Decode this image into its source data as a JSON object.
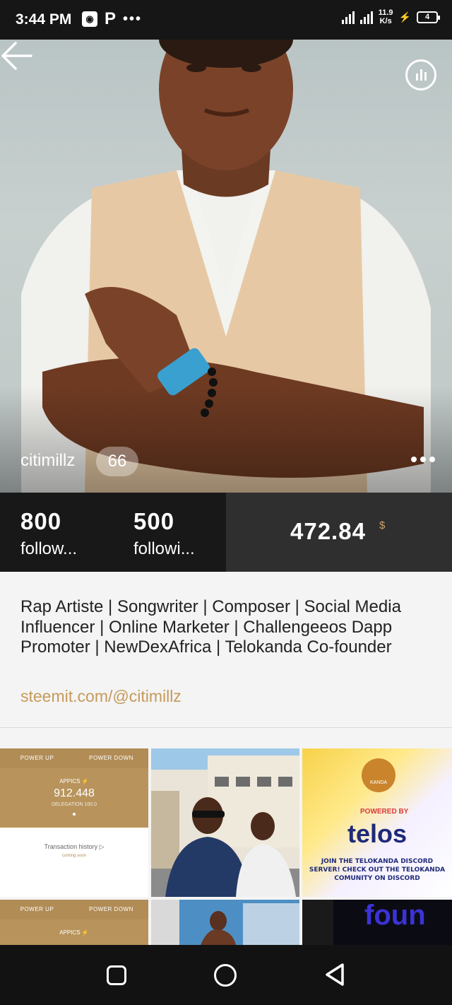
{
  "status_bar": {
    "time": "3:44 PM",
    "net_speed": "11.9",
    "net_unit": "K/s",
    "battery": "4"
  },
  "profile": {
    "username": "citimillz",
    "reputation": "66",
    "followers_count": "800",
    "followers_label": "follow...",
    "following_count": "500",
    "following_label": "followi...",
    "balance": "472.84",
    "currency": "$"
  },
  "bio": {
    "text": "Rap Artiste | Songwriter | Composer | Social Media Influencer | Online Marketer | Challengeeos Dapp Promoter | NewDexAfrica | Telokanda Co-founder",
    "link": "steemit.com/@citimillz"
  },
  "posts": {
    "wallet1": {
      "tab_up": "POWER UP",
      "tab_down": "POWER DOWN",
      "label": "APPICS ⚡",
      "value": "912.448",
      "sub": "DELEGATION 100.0",
      "history": "Transaction history ▷",
      "coming": "coming soon"
    },
    "telos": {
      "kanda": "KANDA",
      "powered": "POWERED BY",
      "word": "telos",
      "join": "JOIN THE TELOKANDA DISCORD SERVER! CHECK OUT THE TELOKANDA COMUNITY ON DISCORD"
    },
    "wallet2": {
      "tab_up": "POWER UP",
      "tab_down": "POWER DOWN",
      "label": "APPICS ⚡"
    },
    "dark": {
      "word": "foun"
    }
  },
  "colors": {
    "accent": "#c59a5a",
    "stats_bg": "#181818",
    "balance_bg": "#2f2f2f"
  }
}
